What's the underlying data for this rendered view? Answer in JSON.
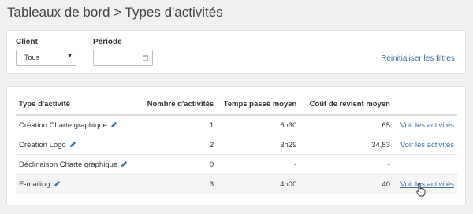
{
  "header": {
    "title": "Tableaux de bord > Types d'activités"
  },
  "filters": {
    "client_label": "Client",
    "client_value": "Tous",
    "period_label": "Période",
    "reset_label": "Réinitialiser les filtres"
  },
  "table": {
    "headers": [
      "Type d'activité",
      "Nombre d'activités",
      "Temps passé moyen",
      "Coût de revient moyen",
      ""
    ],
    "rows": [
      {
        "type": "Création Charte graphique",
        "count": "1",
        "time": "6h30",
        "cost": "65",
        "action": "Voir les activités"
      },
      {
        "type": "Création Logo",
        "count": "2",
        "time": "3h29",
        "cost": "34,83",
        "action": "Voir les activités"
      },
      {
        "type": "Déclinaison Charte graphique",
        "count": "0",
        "time": "-",
        "cost": "-",
        "action": ""
      },
      {
        "type": "E-mailing",
        "count": "3",
        "time": "4h00",
        "cost": "40",
        "action": "Voir les activités"
      }
    ]
  },
  "colors": {
    "link": "#3a6fa5",
    "hover_row": "#f5f5f5",
    "border": "#dcdcdc"
  },
  "icons": {
    "edit": "pencil-icon",
    "calendar": "calendar-icon",
    "dropdown": "caret-down-icon",
    "pointer": "hand-cursor-icon"
  }
}
